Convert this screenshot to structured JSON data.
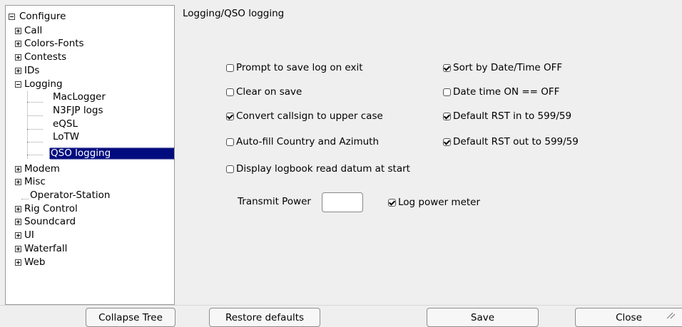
{
  "tree": {
    "root": "Configure",
    "items": [
      {
        "label": "Call",
        "expander": "plus",
        "level": 1
      },
      {
        "label": "Colors-Fonts",
        "expander": "plus",
        "level": 1
      },
      {
        "label": "Contests",
        "expander": "plus",
        "level": 1
      },
      {
        "label": "IDs",
        "expander": "plus",
        "level": 1
      },
      {
        "label": "Logging",
        "expander": "minus",
        "level": 1
      },
      {
        "label": "MacLogger",
        "expander": "none",
        "level": 2
      },
      {
        "label": "N3FJP logs",
        "expander": "none",
        "level": 2
      },
      {
        "label": "eQSL",
        "expander": "none",
        "level": 2
      },
      {
        "label": "LoTW",
        "expander": "none",
        "level": 2
      },
      {
        "label": "QSO logging",
        "expander": "none",
        "level": 2,
        "selected": true
      },
      {
        "label": "Modem",
        "expander": "plus",
        "level": 1
      },
      {
        "label": "Misc",
        "expander": "plus",
        "level": 1
      },
      {
        "label": "Operator-Station",
        "expander": "none",
        "level": 1
      },
      {
        "label": "Rig Control",
        "expander": "plus",
        "level": 1
      },
      {
        "label": "Soundcard",
        "expander": "plus",
        "level": 1
      },
      {
        "label": "UI",
        "expander": "plus",
        "level": 1
      },
      {
        "label": "Waterfall",
        "expander": "plus",
        "level": 1
      },
      {
        "label": "Web",
        "expander": "plus",
        "level": 1
      }
    ]
  },
  "panel": {
    "title": "Logging/QSO logging",
    "checkboxes": [
      {
        "label": "Prompt to save log on exit",
        "checked": false
      },
      {
        "label": "Clear on save",
        "checked": false
      },
      {
        "label": "Convert callsign to upper case",
        "checked": true
      },
      {
        "label": "Auto-fill Country and Azimuth",
        "checked": false
      },
      {
        "label": "Display logbook read datum at start",
        "checked": false
      },
      {
        "label": "Sort by Date/Time OFF",
        "checked": true
      },
      {
        "label": "Date time ON == OFF",
        "checked": false
      },
      {
        "label": "Default RST in to 599/59",
        "checked": true
      },
      {
        "label": "Default RST out to 599/59",
        "checked": true
      }
    ],
    "transmit_power_label": "Transmit Power",
    "transmit_power_value": "",
    "log_power_meter": {
      "label": "Log power meter",
      "checked": true
    }
  },
  "buttons": {
    "collapse_tree": "Collapse Tree",
    "restore_defaults": "Restore defaults",
    "save": "Save",
    "close": "Close"
  }
}
